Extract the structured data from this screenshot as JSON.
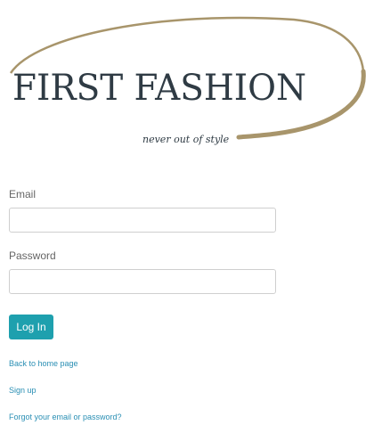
{
  "brand": {
    "name": "FIRST FASHION",
    "tagline": "never out of style",
    "ring_color": "#a8956b",
    "text_color": "#2f3b44"
  },
  "form": {
    "email_label": "Email",
    "email_value": "",
    "email_placeholder": "",
    "password_label": "Password",
    "password_value": "",
    "password_placeholder": "",
    "submit_label": "Log In",
    "button_color": "#1ea0ae"
  },
  "links": {
    "back_home": "Back to home page",
    "sign_up": "Sign up",
    "forgot": "Forgot your email or password?"
  }
}
